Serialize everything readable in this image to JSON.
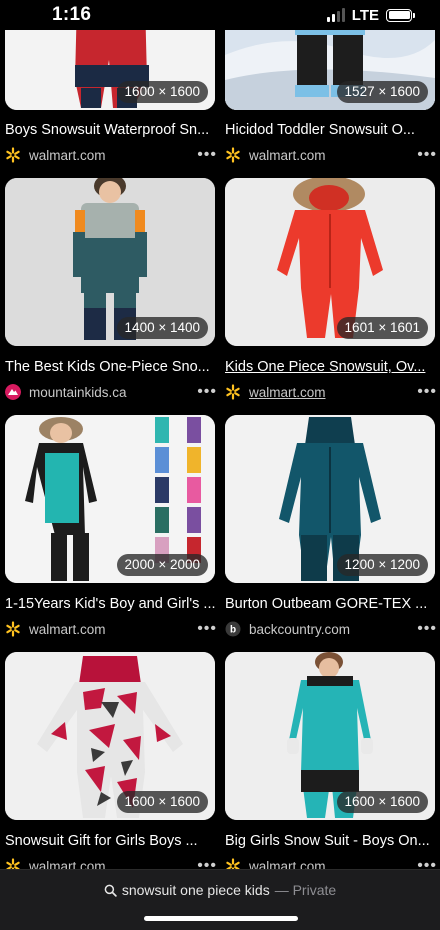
{
  "status": {
    "time": "1:16",
    "network": "LTE",
    "signal_bars": 2,
    "battery_level": 1.0
  },
  "results": [
    {
      "id": "r1",
      "dims": "1600 × 1600",
      "title": "Boys Snowsuit Waterproof Sn...",
      "source": "walmart.com",
      "favicon": "walmart-spark-icon",
      "link": false
    },
    {
      "id": "r2",
      "dims": "1527 × 1600",
      "title": "Hicidod Toddler Snowsuit O...",
      "source": "walmart.com",
      "favicon": "walmart-spark-icon",
      "link": false
    },
    {
      "id": "r3",
      "dims": "1400 × 1400",
      "title": "The Best Kids One-Piece Sno...",
      "source": "mountainkids.ca",
      "favicon": "mountainkids-icon",
      "link": false
    },
    {
      "id": "r4",
      "dims": "1601 × 1601",
      "title": "Kids One Piece Snowsuit, Ov...",
      "source": "walmart.com",
      "favicon": "walmart-spark-icon",
      "link": true
    },
    {
      "id": "r5",
      "dims": "2000 × 2000",
      "title": "1-15Years Kid's Boy and Girl's ...",
      "source": "walmart.com",
      "favicon": "walmart-spark-icon",
      "link": false
    },
    {
      "id": "r6",
      "dims": "1200 × 1200",
      "title": "Burton Outbeam GORE-TEX ...",
      "source": "backcountry.com",
      "favicon": "backcountry-icon",
      "link": false
    },
    {
      "id": "r7",
      "dims": "1600 × 1600",
      "title": "Snowsuit Gift for Girls Boys ...",
      "source": "walmart.com",
      "favicon": "walmart-spark-icon",
      "link": false
    },
    {
      "id": "r8",
      "dims": "1600 × 1600",
      "title": "Big Girls Snow Suit - Boys On...",
      "source": "walmart.com",
      "favicon": "walmart-spark-icon",
      "link": false
    }
  ],
  "more_label": "•••",
  "search": {
    "query": "snowsuit one piece kids",
    "mode": "— Private",
    "icon": "search-icon"
  },
  "colors": {
    "walmart": "#ffc220",
    "mountainkids": "#d81b60",
    "backcountry": "#444444"
  }
}
